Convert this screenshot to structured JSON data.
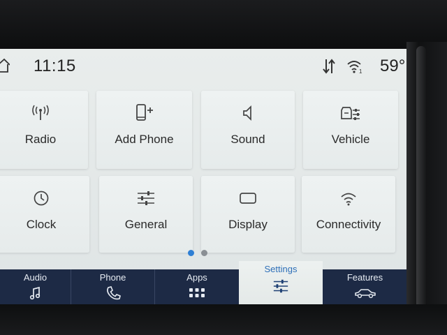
{
  "status_bar": {
    "time": "11:15",
    "temperature": "59°"
  },
  "tiles": [
    {
      "label": "Radio",
      "icon": "radio-antenna-icon"
    },
    {
      "label": "Add Phone",
      "icon": "add-phone-icon"
    },
    {
      "label": "Sound",
      "icon": "speaker-icon"
    },
    {
      "label": "Vehicle",
      "icon": "vehicle-settings-icon"
    },
    {
      "label": "Clock",
      "icon": "clock-icon"
    },
    {
      "label": "General",
      "icon": "sliders-icon"
    },
    {
      "label": "Display",
      "icon": "display-icon"
    },
    {
      "label": "Connectivity",
      "icon": "wifi-icon"
    }
  ],
  "pagination": {
    "current_page": 1,
    "total_pages": 2
  },
  "nav": [
    {
      "label": "Audio",
      "icon": "music-note-icon"
    },
    {
      "label": "Phone",
      "icon": "phone-handset-icon"
    },
    {
      "label": "Apps",
      "icon": "apps-grid-icon"
    },
    {
      "label": "Settings",
      "icon": "settings-sliders-icon",
      "active": true
    },
    {
      "label": "Features",
      "icon": "car-icon"
    }
  ],
  "colors": {
    "nav_background": "#1d2a45",
    "active_accent": "#2e6fb8",
    "dot_active": "#2e7fd4",
    "dot_inactive": "#8a8f94"
  }
}
